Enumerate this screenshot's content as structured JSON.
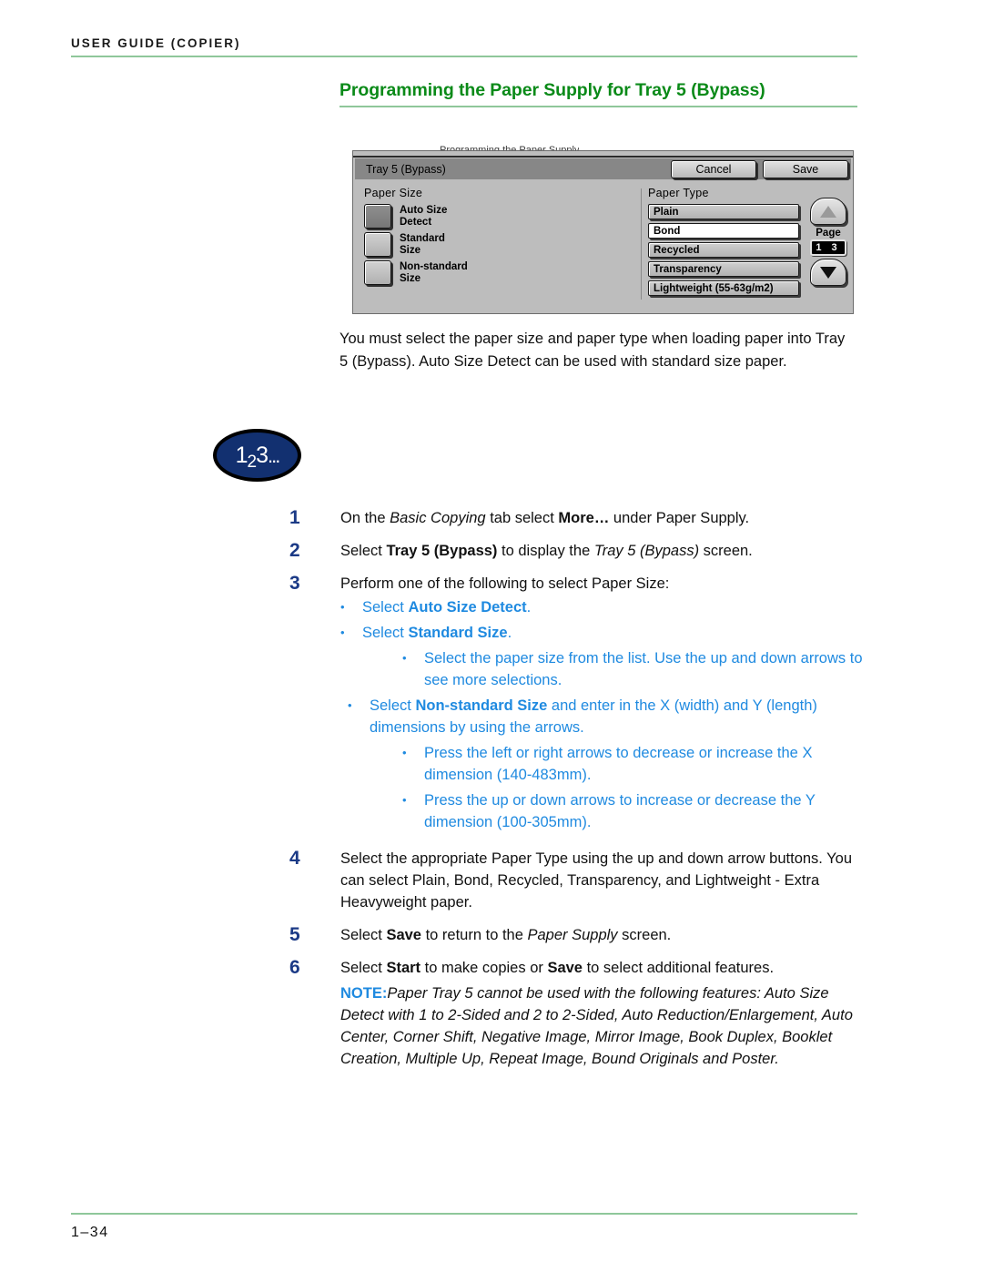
{
  "header": {
    "running_head": "User Guide (Copier)"
  },
  "section": {
    "title": "Programming the Paper Supply for Tray 5 (Bypass)"
  },
  "figure": {
    "ghost_clipped_text": "Programming the Paper Supply",
    "titlebar": {
      "label": "Tray 5 (Bypass)",
      "cancel_label": "Cancel",
      "save_label": "Save"
    },
    "paper_size": {
      "heading": "Paper Size",
      "options": [
        {
          "label": "Auto Size\nDetect",
          "selected": true
        },
        {
          "label": "Standard\nSize",
          "selected": false
        },
        {
          "label": "Non-standard\nSize",
          "selected": false
        }
      ]
    },
    "paper_type": {
      "heading": "Paper Type",
      "options": [
        {
          "label": "Plain",
          "selected": false
        },
        {
          "label": "Bond",
          "selected": true
        },
        {
          "label": "Recycled",
          "selected": false
        },
        {
          "label": "Transparency",
          "selected": false
        },
        {
          "label": "Lightweight (55-63g/m2)",
          "selected": false
        }
      ]
    },
    "pager": {
      "up_arrow": "scroll-up",
      "down_arrow": "scroll-down",
      "label": "Page",
      "readout": "1 3"
    }
  },
  "intro": {
    "paragraph": "You must select the paper size and paper type when loading paper into Tray 5 (Bypass).  Auto Size Detect can be used with standard size paper."
  },
  "badge": {
    "d1": "1",
    "d2": "2",
    "d3": "3",
    "dots": "..."
  },
  "steps": [
    {
      "number": "1",
      "text_parts": [
        {
          "t": "On the ",
          "style": "plain"
        },
        {
          "t": "Basic Copying",
          "style": "italic"
        },
        {
          "t": " tab select ",
          "style": "plain"
        },
        {
          "t": "More…",
          "style": "bold"
        },
        {
          "t": " under Paper Supply.",
          "style": "plain"
        }
      ],
      "plain_text": "On the Basic Copying tab select More… under Paper Supply."
    },
    {
      "number": "2",
      "plain_text": "Select Tray 5 (Bypass) to display the Tray 5 (Bypass) screen."
    },
    {
      "number": "3",
      "plain_text": "Perform one of the following to select Paper Size:",
      "bullets": [
        {
          "level": 1,
          "plain_text": "Select Auto Size Detect."
        },
        {
          "level": 1,
          "plain_text": "Select Standard Size."
        },
        {
          "level": 2,
          "plain_text": "Select the paper size from the list. Use the up and down arrows to see more selections."
        },
        {
          "level": 1,
          "plain_text": "Select Non-standard Size and enter in the X (width) and Y (length) dimensions by using the arrows."
        },
        {
          "level": 2,
          "plain_text": "Press the left or right arrows to decrease or increase the X dimension (140-483mm)."
        },
        {
          "level": 2,
          "plain_text": "Press the up or down arrows to increase or decrease the Y dimension (100-305mm)."
        }
      ]
    },
    {
      "number": "4",
      "plain_text": "Select the appropriate Paper Type using the up and down arrow buttons. You can select Plain, Bond, Recycled, Transparency, and Lightweight - Extra Heavyweight paper."
    },
    {
      "number": "5",
      "plain_text": "Select Save to return to the Paper Supply screen."
    },
    {
      "number": "6",
      "plain_text": "Select Start to make copies or Save to select additional features."
    }
  ],
  "note": {
    "keyword": "NOTE:",
    "body": "Paper Tray 5 cannot be used with the following features: Auto Size Detect with 1 to 2-Sided and 2 to 2-Sided, Auto Reduction/Enlargement, Auto Center, Corner Shift, Negative Image, Mirror Image, Book Duplex, Booklet Creation, Multiple Up, Repeat Image, Bound Originals and Poster."
  },
  "footer": {
    "page_number": "1–34"
  },
  "colors": {
    "heading_green": "#0a8a18",
    "rule_green": "#8fc79a",
    "step_number_blue": "#1b3a86",
    "bullet_blue": "#1f8ae0",
    "badge_navy": "#123070"
  }
}
